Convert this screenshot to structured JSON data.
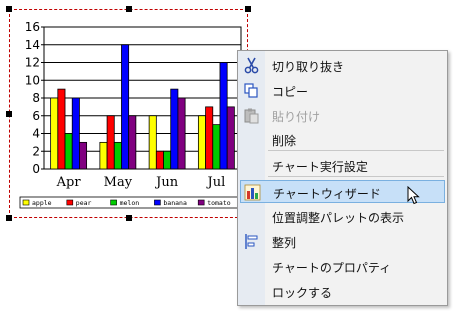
{
  "chart_data": {
    "type": "bar",
    "categories": [
      "Apr",
      "May",
      "Jun",
      "Jul"
    ],
    "series": [
      {
        "name": "apple",
        "color": "#ffff00",
        "values": [
          8,
          3,
          6,
          6
        ]
      },
      {
        "name": "pear",
        "color": "#ff0000",
        "values": [
          9,
          6,
          2,
          7
        ]
      },
      {
        "name": "melon",
        "color": "#00cc00",
        "values": [
          4,
          3,
          2,
          5
        ]
      },
      {
        "name": "banana",
        "color": "#0000ff",
        "values": [
          8,
          14,
          9,
          12
        ]
      },
      {
        "name": "tomato",
        "color": "#800080",
        "values": [
          3,
          6,
          8,
          7
        ]
      }
    ],
    "ylim": [
      0,
      16
    ],
    "yticks": [
      "0",
      "2",
      "4",
      "6",
      "8",
      "10",
      "12",
      "14",
      "16"
    ],
    "grid": true,
    "legend": "bottom",
    "title": "",
    "xlabel": "",
    "ylabel": ""
  },
  "context_menu": {
    "items": [
      {
        "label": "切り取り抜き",
        "icon": "scissors-icon",
        "disabled": false,
        "highlighted": false
      },
      {
        "label": "コピー",
        "icon": "copy-icon",
        "disabled": false,
        "highlighted": false
      },
      {
        "label": "貼り付け",
        "icon": "paste-icon",
        "disabled": true,
        "highlighted": false
      },
      {
        "label": "削除",
        "icon": "",
        "disabled": false,
        "highlighted": false
      },
      {
        "label": "チャート実行設定",
        "icon": "",
        "disabled": false,
        "highlighted": false
      },
      {
        "label": "チャートウィザード",
        "icon": "chart-wizard-icon",
        "disabled": false,
        "highlighted": true
      },
      {
        "label": "位置調整パレットの表示",
        "icon": "",
        "disabled": false,
        "highlighted": false
      },
      {
        "label": "整列",
        "icon": "align-icon",
        "disabled": false,
        "highlighted": false
      },
      {
        "label": "チャートのプロパティ",
        "icon": "",
        "disabled": false,
        "highlighted": false
      },
      {
        "label": "ロックする",
        "icon": "",
        "disabled": false,
        "highlighted": false
      }
    ]
  }
}
